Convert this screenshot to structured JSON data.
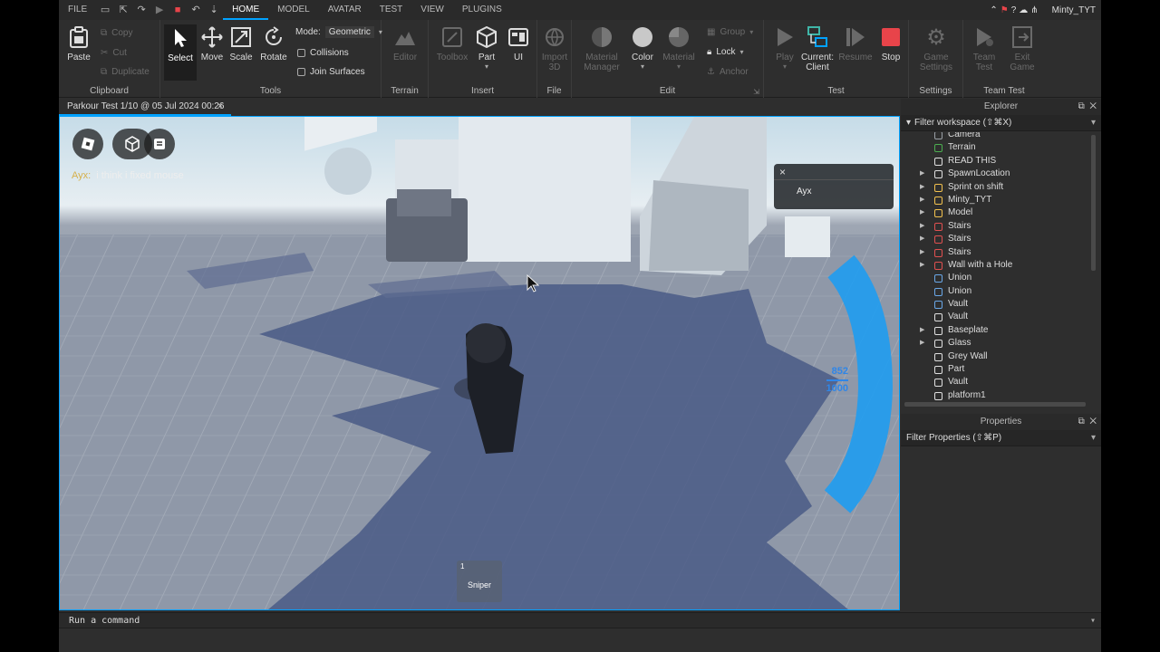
{
  "menubar": {
    "file": "FILE",
    "tabs": [
      "HOME",
      "MODEL",
      "AVATAR",
      "TEST",
      "VIEW",
      "PLUGINS"
    ],
    "active_tab": "HOME",
    "username": "Minty_TYT"
  },
  "ribbon": {
    "clipboard": {
      "label": "Clipboard",
      "paste": "Paste",
      "copy": "Copy",
      "cut": "Cut",
      "duplicate": "Duplicate"
    },
    "tools": {
      "label": "Tools",
      "select": "Select",
      "move": "Move",
      "scale": "Scale",
      "rotate": "Rotate",
      "mode_label": "Mode:",
      "mode_value": "Geometric",
      "collisions": "Collisions",
      "join_surfaces": "Join Surfaces"
    },
    "terrain": {
      "label": "Terrain",
      "editor": "Editor"
    },
    "insert": {
      "label": "Insert",
      "toolbox": "Toolbox",
      "part": "Part",
      "ui": "UI"
    },
    "file": {
      "label": "File",
      "import_line1": "Import",
      "import_line2": "3D"
    },
    "edit": {
      "label": "Edit",
      "material_manager_1": "Material",
      "material_manager_2": "Manager",
      "color": "Color",
      "material": "Material",
      "group": "Group",
      "lock": "Lock",
      "anchor": "Anchor"
    },
    "test": {
      "label": "Test",
      "play": "Play",
      "current_1": "Current:",
      "current_2": "Client",
      "resume": "Resume",
      "stop": "Stop"
    },
    "settings": {
      "label": "Settings",
      "game_1": "Game",
      "game_2": "Settings"
    },
    "team_test": {
      "label": "Team Test",
      "team_1": "Team",
      "team_2": "Test",
      "exit_1": "Exit",
      "exit_2": "Game"
    }
  },
  "document_tab": {
    "title": "Parkour Test 1/10 @ 05 Jul 2024 00:26",
    "close": "×"
  },
  "viewport": {
    "chat": {
      "name": "Ayx:",
      "message": "i think i fixed mouse"
    },
    "playerlist": {
      "close": "×",
      "player": "Ayx"
    },
    "hotbar": {
      "slot": "1",
      "item": "Sniper"
    },
    "ammo": {
      "current": "852",
      "max": "1000"
    }
  },
  "explorer": {
    "title": "Explorer",
    "filter": "Filter workspace (⇧⌘X)",
    "items": [
      {
        "name": "Camera",
        "expandable": false,
        "icon_color": "#9aa0a6"
      },
      {
        "name": "Terrain",
        "expandable": false,
        "icon_color": "#4caf50"
      },
      {
        "name": "READ THIS",
        "expandable": false,
        "icon_color": "#e0e0e0"
      },
      {
        "name": "SpawnLocation",
        "expandable": true,
        "icon_color": "#e0e0e0"
      },
      {
        "name": "Sprint on shift",
        "expandable": true,
        "icon_color": "#f2c14e"
      },
      {
        "name": "Minty_TYT",
        "expandable": true,
        "icon_color": "#f2c14e"
      },
      {
        "name": "Model",
        "expandable": true,
        "icon_color": "#f2c14e"
      },
      {
        "name": "Stairs",
        "expandable": true,
        "icon_color": "#e05050"
      },
      {
        "name": "Stairs",
        "expandable": true,
        "icon_color": "#e05050"
      },
      {
        "name": "Stairs",
        "expandable": true,
        "icon_color": "#e05050"
      },
      {
        "name": "Wall with a Hole",
        "expandable": true,
        "icon_color": "#e05050"
      },
      {
        "name": "Union",
        "expandable": false,
        "icon_color": "#6aa8e8"
      },
      {
        "name": "Union",
        "expandable": false,
        "icon_color": "#6aa8e8"
      },
      {
        "name": "Vault",
        "expandable": false,
        "icon_color": "#6aa8e8"
      },
      {
        "name": "Vault",
        "expandable": false,
        "icon_color": "#e0e0e0"
      },
      {
        "name": "Baseplate",
        "expandable": true,
        "icon_color": "#e0e0e0"
      },
      {
        "name": "Glass",
        "expandable": true,
        "icon_color": "#e0e0e0"
      },
      {
        "name": "Grey Wall",
        "expandable": false,
        "icon_color": "#e0e0e0"
      },
      {
        "name": "Part",
        "expandable": false,
        "icon_color": "#e0e0e0"
      },
      {
        "name": "Vault",
        "expandable": false,
        "icon_color": "#e0e0e0"
      },
      {
        "name": "platform1",
        "expandable": false,
        "icon_color": "#e0e0e0"
      }
    ]
  },
  "properties": {
    "title": "Properties",
    "filter": "Filter Properties (⇧⌘P)"
  },
  "command_bar": {
    "placeholder": "Run a command"
  },
  "colors": {
    "accent": "#00a2ff",
    "stop": "#e8444a",
    "ammo": "#2f86e8",
    "panel_bg": "#2e2e2e"
  }
}
